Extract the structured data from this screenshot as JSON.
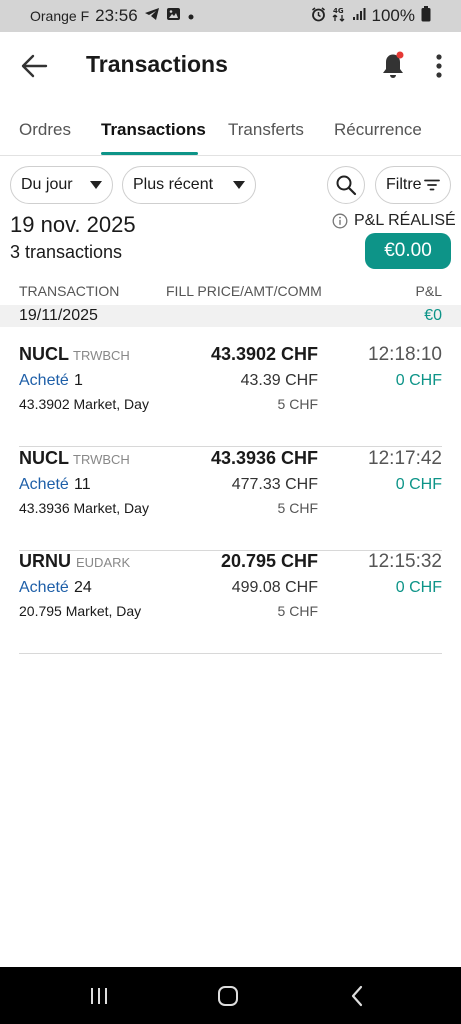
{
  "status_bar": {
    "carrier": "Orange F",
    "time": "23:56",
    "battery": "100%",
    "icons": [
      "telegram-icon",
      "gallery-icon",
      "dot-icon",
      "alarm-icon",
      "4g-icon",
      "signal-icon",
      "battery-icon"
    ]
  },
  "header": {
    "title": "Transactions"
  },
  "tabs": [
    {
      "label": "Ordres",
      "active": false
    },
    {
      "label": "Transactions",
      "active": true
    },
    {
      "label": "Transferts",
      "active": false
    },
    {
      "label": "Récurrence",
      "active": false
    }
  ],
  "filters": {
    "period": "Du jour",
    "sort": "Plus récent",
    "filter_label": "Filtre"
  },
  "summary": {
    "date": "19 nov. 2025",
    "count": "3 transactions",
    "pnl_label": "P&L RÉALISÉ",
    "pnl_value": "€0.00"
  },
  "columns": {
    "transaction": "TRANSACTION",
    "fill": "FILL PRICE/AMT/COMM",
    "pnl": "P&L"
  },
  "date_group": {
    "date": "19/11/2025",
    "pnl": "€0"
  },
  "transactions": [
    {
      "symbol": "NUCL",
      "exchange": "TRWBCH",
      "fill_price": "43.3902 CHF",
      "time": "12:18:10",
      "action": "Acheté",
      "quantity": "1",
      "amount": "43.39 CHF",
      "pnl": "0 CHF",
      "description": "43.3902 Market, Day",
      "commission": "5 CHF"
    },
    {
      "symbol": "NUCL",
      "exchange": "TRWBCH",
      "fill_price": "43.3936 CHF",
      "time": "12:17:42",
      "action": "Acheté",
      "quantity": "11",
      "amount": "477.33 CHF",
      "pnl": "0 CHF",
      "description": "43.3936 Market, Day",
      "commission": "5 CHF"
    },
    {
      "symbol": "URNU",
      "exchange": "EUDARK",
      "fill_price": "20.795 CHF",
      "time": "12:15:32",
      "action": "Acheté",
      "quantity": "24",
      "amount": "499.08 CHF",
      "pnl": "0 CHF",
      "description": "20.795 Market, Day",
      "commission": "5 CHF"
    }
  ],
  "colors": {
    "accent": "#0d9488",
    "buy": "#1e5fa8",
    "notification_dot": "#e53935"
  }
}
